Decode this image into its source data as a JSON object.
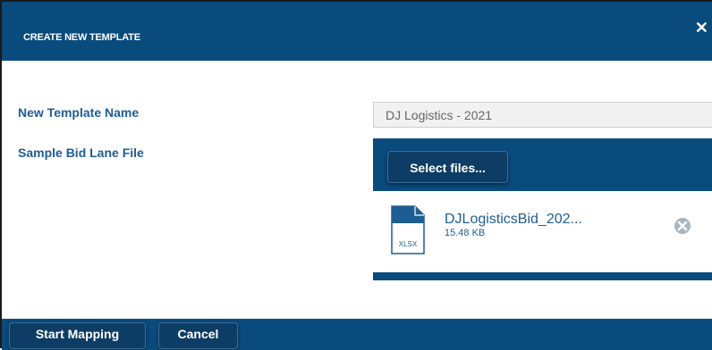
{
  "dialog": {
    "title": "CREATE NEW TEMPLATE",
    "close_icon": "close-icon"
  },
  "form": {
    "template_name_label": "New Template Name",
    "template_name_value": "DJ Logistics - 2021",
    "sample_file_label": "Sample Bid Lane File"
  },
  "upload": {
    "select_label": "Select files...",
    "files": [
      {
        "name": "DJLogisticsBid_202...",
        "size": "15.48 KB",
        "type_label": "XLSX",
        "icon": "xlsx-file-icon",
        "remove_icon": "remove-file-icon"
      }
    ]
  },
  "footer": {
    "start_label": "Start Mapping",
    "cancel_label": "Cancel"
  },
  "colors": {
    "header_blue": "#0a4b7e",
    "button_blue": "#0d3d64",
    "label_blue": "#1e5d94"
  }
}
